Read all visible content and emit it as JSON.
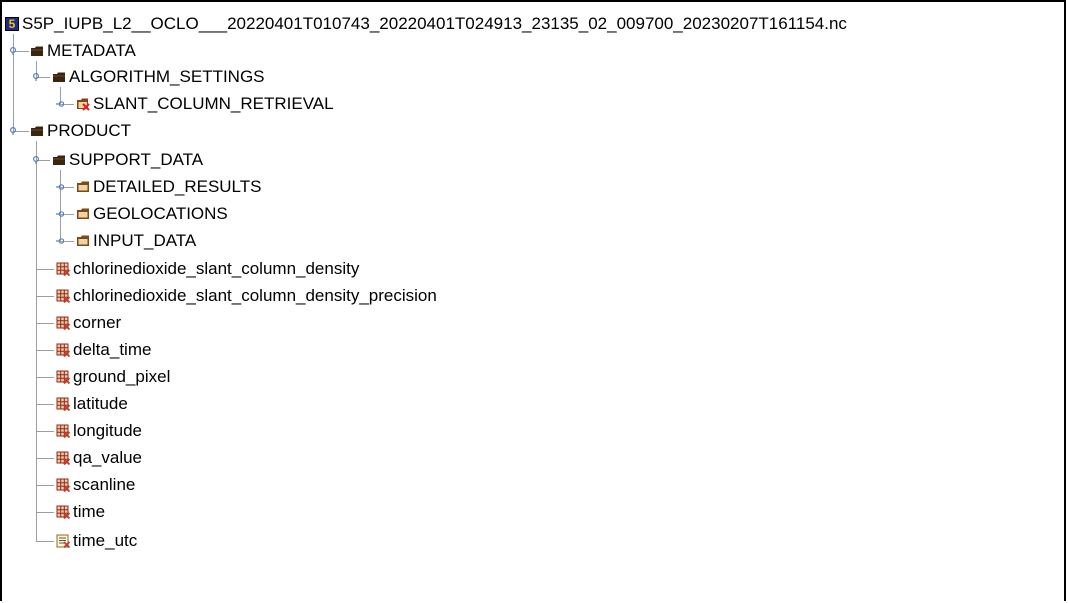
{
  "tree": {
    "root": {
      "label": "S5P_IUPB_L2__OCLO___20220401T010743_20220401T024913_23135_02_009700_20230207T161154.nc",
      "icon": "netcdf-file-icon"
    },
    "metadata": {
      "label": "METADATA",
      "algorithm_settings": {
        "label": "ALGORITHM_SETTINGS",
        "slant_column_retrieval": {
          "label": "SLANT_COLUMN_RETRIEVAL"
        }
      }
    },
    "product": {
      "label": "PRODUCT",
      "support_data": {
        "label": "SUPPORT_DATA",
        "children": [
          "DETAILED_RESULTS",
          "GEOLOCATIONS",
          "INPUT_DATA"
        ]
      },
      "datasets": [
        "chlorinedioxide_slant_column_density",
        "chlorinedioxide_slant_column_density_precision",
        "corner",
        "delta_time",
        "ground_pixel",
        "latitude",
        "longitude",
        "qa_value",
        "scanline",
        "time"
      ],
      "text_dataset": "time_utc"
    }
  },
  "colors": {
    "folder_open": "#3b2410",
    "folder_closed": "#7a4a1a",
    "folder_attr_mark": "#e02020",
    "dataset_red": "#c0392b",
    "tree_line": "#9aa0a6",
    "toggle": "#5b7fb5"
  }
}
